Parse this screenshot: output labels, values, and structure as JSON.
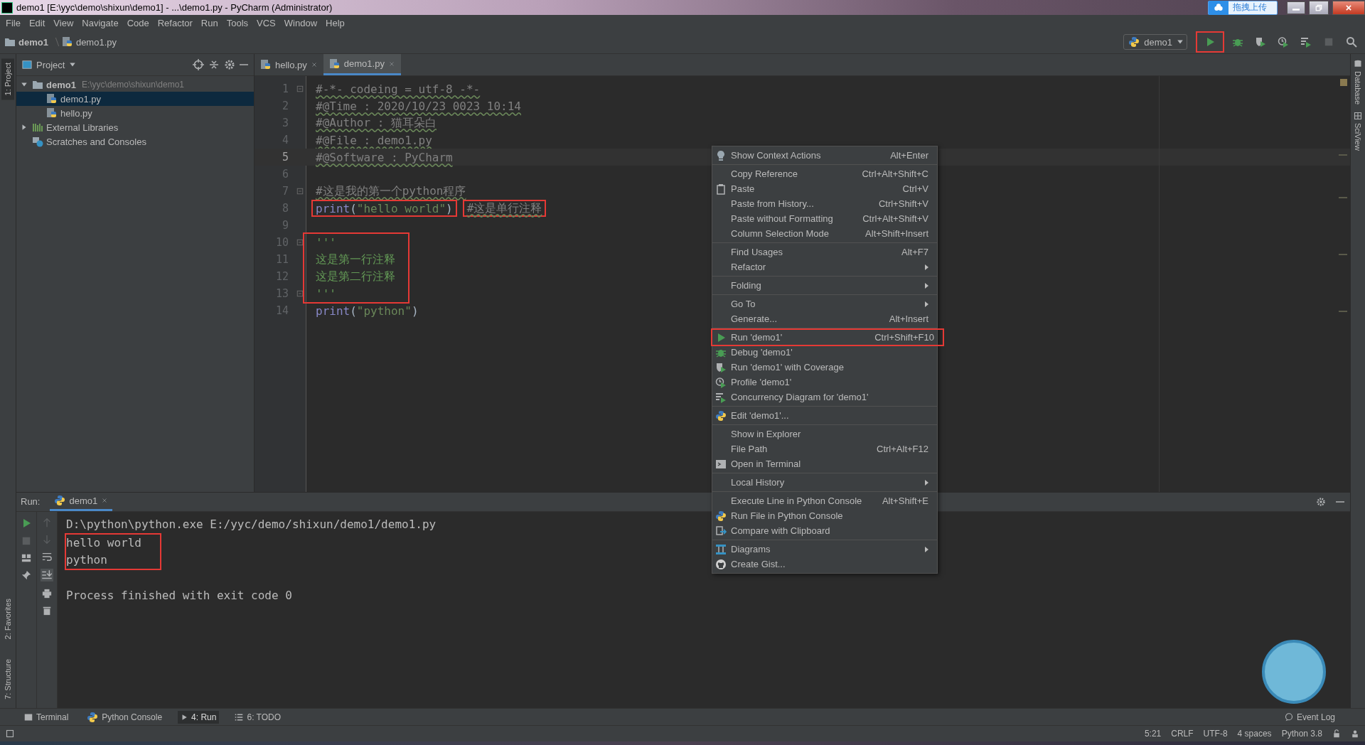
{
  "window": {
    "title": "demo1 [E:\\yyc\\demo\\shixun\\demo1] - ...\\demo1.py - PyCharm (Administrator)",
    "upload_button": "拖拽上传"
  },
  "menu": [
    "File",
    "Edit",
    "View",
    "Navigate",
    "Code",
    "Refactor",
    "Run",
    "Tools",
    "VCS",
    "Window",
    "Help"
  ],
  "breadcrumb": [
    "demo1",
    "demo1.py"
  ],
  "toolbar": {
    "run_config": "demo1",
    "run_boxed": true
  },
  "left_strip": [
    {
      "label": "1: Project",
      "selected": true
    },
    {
      "label": "2: Favorites",
      "selected": false
    },
    {
      "label": "7: Structure",
      "selected": false
    }
  ],
  "right_strip": [
    "Database",
    "SciView"
  ],
  "project": {
    "title": "Project",
    "tree": [
      {
        "label": "demo1",
        "path": "E:\\yyc\\demo\\shixun\\demo1",
        "kind": "folder",
        "expanded": true,
        "selected": false,
        "children": [
          {
            "label": "demo1.py",
            "kind": "python",
            "selected": true
          },
          {
            "label": "hello.py",
            "kind": "python",
            "selected": false
          }
        ]
      },
      {
        "label": "External Libraries",
        "kind": "library",
        "expanded": false,
        "selected": false
      },
      {
        "label": "Scratches and Consoles",
        "kind": "scratch",
        "selected": false
      }
    ]
  },
  "editor": {
    "tabs": [
      {
        "label": "hello.py",
        "selected": false
      },
      {
        "label": "demo1.py",
        "selected": true
      }
    ],
    "lines": [
      {
        "number": "1",
        "fold": true,
        "current": false,
        "boxed": false,
        "parts": [
          {
            "boxed": false,
            "tokens": [
              {
                "text": "#-*- codeing = utf-8 -*-",
                "kind": "comment"
              }
            ]
          }
        ]
      },
      {
        "number": "2",
        "fold": false,
        "current": false,
        "boxed": false,
        "parts": [
          {
            "boxed": false,
            "tokens": [
              {
                "text": "#@Time : 2020/10/23 0023 10:14",
                "kind": "comment"
              }
            ]
          }
        ]
      },
      {
        "number": "3",
        "fold": false,
        "current": false,
        "boxed": false,
        "parts": [
          {
            "boxed": false,
            "tokens": [
              {
                "text": "#@Author : 猫耳朵白",
                "kind": "comment"
              }
            ]
          }
        ]
      },
      {
        "number": "4",
        "fold": false,
        "current": false,
        "boxed": false,
        "parts": [
          {
            "boxed": false,
            "tokens": [
              {
                "text": "#@File : demo1.py",
                "kind": "comment"
              }
            ]
          }
        ]
      },
      {
        "number": "5",
        "fold": false,
        "current": true,
        "boxed": false,
        "parts": [
          {
            "boxed": false,
            "tokens": [
              {
                "text": "#@Software : PyCharm",
                "kind": "comment"
              }
            ]
          }
        ]
      },
      {
        "number": "6",
        "fold": false,
        "current": false,
        "boxed": false
      },
      {
        "number": "7",
        "fold": true,
        "current": false,
        "boxed": false,
        "parts": [
          {
            "boxed": false,
            "tokens": [
              {
                "text": "#这是我的第一个python程序",
                "kind": "comment"
              }
            ]
          }
        ]
      },
      {
        "number": "8",
        "fold": false,
        "current": false,
        "boxed": false,
        "parts": [
          {
            "boxed": true,
            "tokens": [
              {
                "text": "print",
                "kind": "builtin"
              },
              {
                "text": "(",
                "kind": "plain"
              },
              {
                "text": "\"hello world\"",
                "kind": "string"
              },
              {
                "text": ")",
                "kind": "plain"
              }
            ]
          },
          {
            "boxed": true,
            "tokens": [
              {
                "text": "#这是单行注释",
                "kind": "comment"
              }
            ]
          }
        ]
      },
      {
        "number": "9",
        "fold": false,
        "current": false,
        "boxed": false
      },
      {
        "number": "10",
        "fold": true,
        "current": false,
        "boxed": true,
        "parts": [
          {
            "boxed": false,
            "tokens": [
              {
                "text": "'''",
                "kind": "doc"
              }
            ]
          }
        ]
      },
      {
        "number": "11",
        "fold": false,
        "current": false,
        "boxed": true,
        "parts": [
          {
            "boxed": false,
            "tokens": [
              {
                "text": "这是第一行注释",
                "kind": "doc"
              }
            ]
          }
        ]
      },
      {
        "number": "12",
        "fold": false,
        "current": false,
        "boxed": true,
        "parts": [
          {
            "boxed": false,
            "tokens": [
              {
                "text": "这是第二行注释",
                "kind": "doc"
              }
            ]
          }
        ]
      },
      {
        "number": "13",
        "fold": true,
        "current": false,
        "boxed": true,
        "parts": [
          {
            "boxed": false,
            "tokens": [
              {
                "text": "'''",
                "kind": "doc"
              }
            ]
          }
        ]
      },
      {
        "number": "14",
        "fold": false,
        "current": false,
        "boxed": false,
        "parts": [
          {
            "boxed": false,
            "tokens": [
              {
                "text": "print",
                "kind": "builtin"
              },
              {
                "text": "(",
                "kind": "plain"
              },
              {
                "text": "\"python\"",
                "kind": "string"
              },
              {
                "text": ")",
                "kind": "plain"
              }
            ]
          }
        ]
      }
    ]
  },
  "context_menu": [
    [
      {
        "label": "Show Context Actions",
        "shortcut": "Alt+Enter",
        "submenu": false,
        "boxed": false
      }
    ],
    [
      {
        "label": "Copy Reference",
        "shortcut": "Ctrl+Alt+Shift+C",
        "submenu": false,
        "boxed": false
      },
      {
        "label": "Paste",
        "shortcut": "Ctrl+V",
        "submenu": false,
        "boxed": false
      },
      {
        "label": "Paste from History...",
        "shortcut": "Ctrl+Shift+V",
        "submenu": false,
        "boxed": false
      },
      {
        "label": "Paste without Formatting",
        "shortcut": "Ctrl+Alt+Shift+V",
        "submenu": false,
        "boxed": false
      },
      {
        "label": "Column Selection Mode",
        "shortcut": "Alt+Shift+Insert",
        "submenu": false,
        "boxed": false
      }
    ],
    [
      {
        "label": "Find Usages",
        "shortcut": "Alt+F7",
        "submenu": false,
        "boxed": false
      },
      {
        "label": "Refactor",
        "submenu": true,
        "boxed": false
      }
    ],
    [
      {
        "label": "Folding",
        "submenu": true,
        "boxed": false
      }
    ],
    [
      {
        "label": "Go To",
        "submenu": true,
        "boxed": false
      },
      {
        "label": "Generate...",
        "shortcut": "Alt+Insert",
        "submenu": false,
        "boxed": false
      }
    ],
    [
      {
        "label": "Run 'demo1'",
        "shortcut": "Ctrl+Shift+F10",
        "submenu": false,
        "boxed": true
      },
      {
        "label": "Debug 'demo1'",
        "submenu": false,
        "boxed": false
      },
      {
        "label": "Run 'demo1' with Coverage",
        "submenu": false,
        "boxed": false
      },
      {
        "label": "Profile 'demo1'",
        "submenu": false,
        "boxed": false
      },
      {
        "label": "Concurrency Diagram for 'demo1'",
        "submenu": false,
        "boxed": false
      }
    ],
    [
      {
        "label": "Edit 'demo1'...",
        "submenu": false,
        "boxed": false
      }
    ],
    [
      {
        "label": "Show in Explorer",
        "submenu": false,
        "boxed": false
      },
      {
        "label": "File Path",
        "shortcut": "Ctrl+Alt+F12",
        "submenu": false,
        "boxed": false
      },
      {
        "label": "Open in Terminal",
        "submenu": false,
        "boxed": false
      }
    ],
    [
      {
        "label": "Local History",
        "submenu": true,
        "boxed": false
      }
    ],
    [
      {
        "label": "Execute Line in Python Console",
        "shortcut": "Alt+Shift+E",
        "submenu": false,
        "boxed": false
      },
      {
        "label": "Run File in Python Console",
        "submenu": false,
        "boxed": false
      },
      {
        "label": "Compare with Clipboard",
        "submenu": false,
        "boxed": false
      }
    ],
    [
      {
        "label": "Diagrams",
        "submenu": true,
        "boxed": false
      },
      {
        "label": "Create Gist...",
        "submenu": false,
        "boxed": false
      }
    ]
  ],
  "run_panel": {
    "label": "Run:",
    "tab": "demo1",
    "console": [
      {
        "text": "D:\\python\\python.exe E:/yyc/demo/shixun/demo1/demo1.py",
        "boxed": false
      },
      {
        "text": "hello world",
        "boxed": true
      },
      {
        "text": "python",
        "boxed": true
      },
      {
        "boxed": false
      },
      {
        "text": "Process finished with exit code 0",
        "boxed": false
      }
    ]
  },
  "tool_tabs": [
    {
      "label": "Terminal",
      "selected": false
    },
    {
      "label": "Python Console",
      "selected": false
    },
    {
      "label": "4: Run",
      "selected": true
    },
    {
      "label": "6: TODO",
      "selected": false
    }
  ],
  "event_log": "Event Log",
  "status_bar": [
    "5:21",
    "CRLF",
    "UTF-8",
    "4 spaces",
    "Python 3.8"
  ]
}
